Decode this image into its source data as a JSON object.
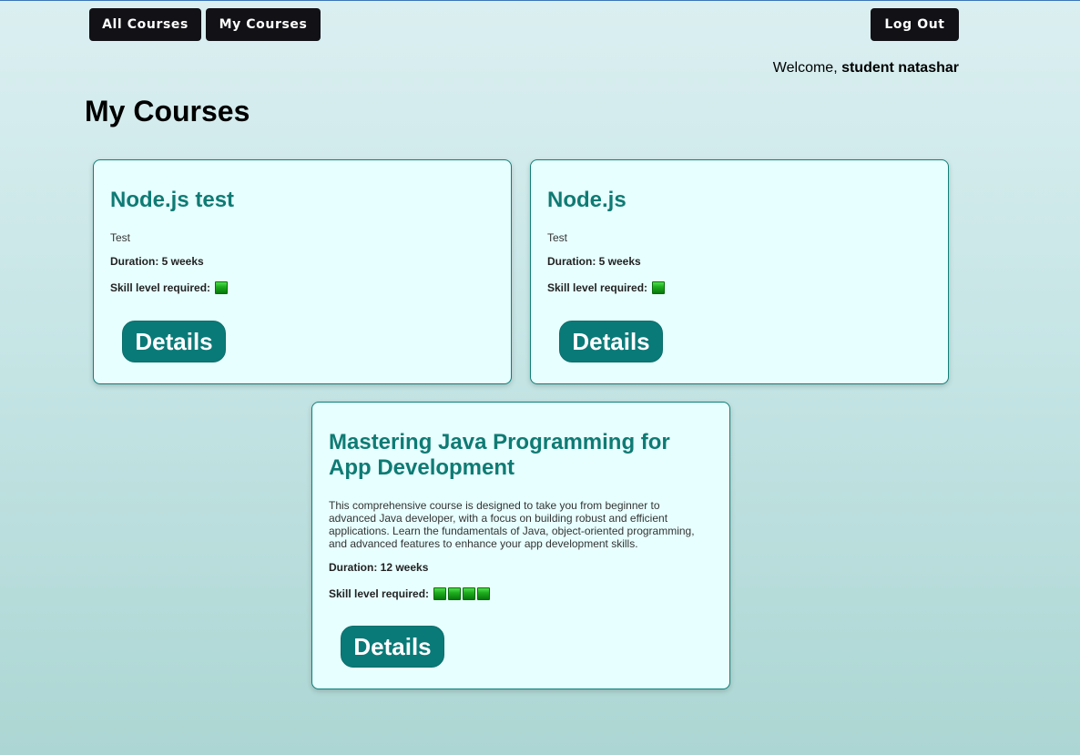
{
  "nav": {
    "all_courses_label": "All Courses",
    "my_courses_label": "My Courses",
    "logout_label": "Log Out"
  },
  "welcome": {
    "prefix": "Welcome, ",
    "username": "student natashar"
  },
  "page_title": "My Courses",
  "courses": [
    {
      "title": "Node.js test",
      "description": "Test",
      "duration": "Duration: 5 weeks",
      "skill_label": "Skill level required:",
      "skill_level": 1,
      "details_label": "Details"
    },
    {
      "title": "Node.js",
      "description": "Test",
      "duration": "Duration: 5 weeks",
      "skill_label": "Skill level required:",
      "skill_level": 1,
      "details_label": "Details"
    },
    {
      "title": "Mastering Java Programming for App Development",
      "description": "This comprehensive course is designed to take you from beginner to advanced Java developer, with a focus on building robust and efficient applications. Learn the fundamentals of Java, object-oriented programming, and advanced features to enhance your app development skills.",
      "duration": "Duration: 12 weeks",
      "skill_label": "Skill level required:",
      "skill_level": 4,
      "details_label": "Details"
    }
  ],
  "colors": {
    "accent": "#0a7a78",
    "title": "#0e7b74",
    "nav_button": "#111116",
    "card_background": "#e8ffff",
    "skill_icon": "#1fae1f"
  },
  "icons": {
    "skill": "green-square-icon"
  }
}
